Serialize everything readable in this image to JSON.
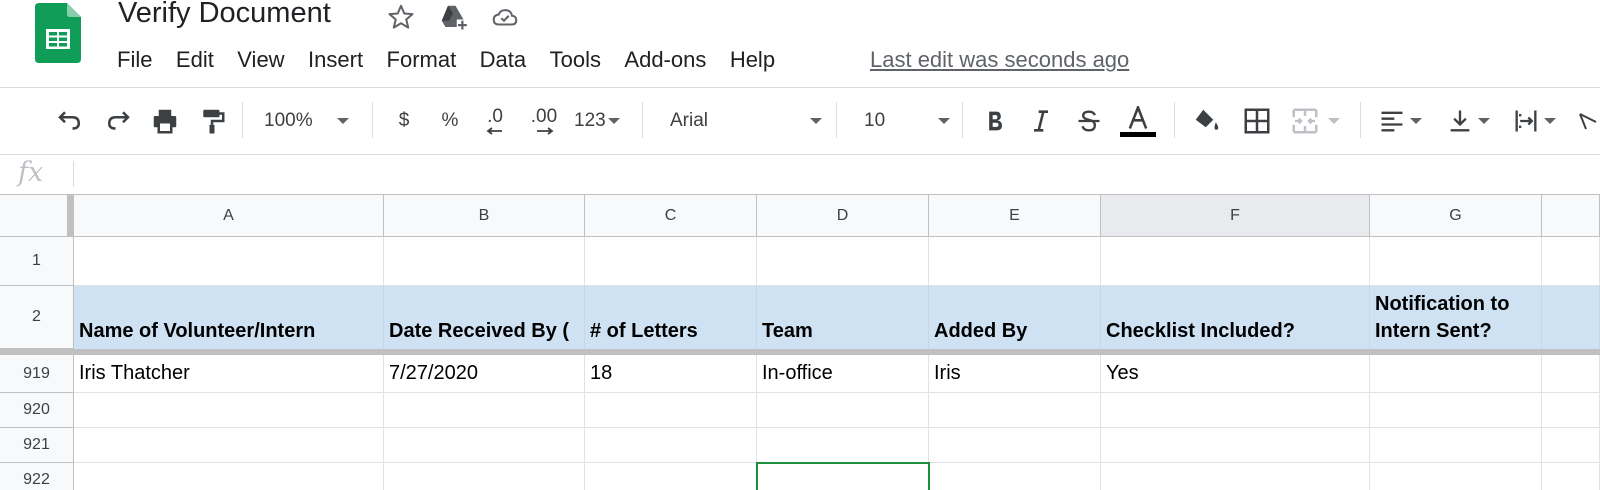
{
  "app": {
    "doc_title": "Verify Document",
    "menu": [
      "File",
      "Edit",
      "View",
      "Insert",
      "Format",
      "Data",
      "Tools",
      "Add-ons",
      "Help"
    ],
    "last_edit": "Last edit was seconds ago"
  },
  "toolbar": {
    "zoom": "100%",
    "currency": "$",
    "percent": "%",
    "decrease_decimal": ".0",
    "increase_decimal": ".00",
    "more_formats": "123",
    "font": "Arial",
    "font_size": "10"
  },
  "formula_bar": {
    "fx_label": "fx",
    "value": ""
  },
  "grid": {
    "columns": [
      "A",
      "B",
      "C",
      "D",
      "E",
      "F",
      "G"
    ],
    "selected_column": "F",
    "rows": [
      {
        "num": "1",
        "cells": [
          "",
          "",
          "",
          "",
          "",
          "",
          ""
        ]
      },
      {
        "num": "2",
        "cells": [
          "Name of Volunteer/Intern",
          "Date Received By (",
          "# of Letters",
          "Team",
          "Added By",
          "Checklist Included?",
          "Notification to Intern Sent?"
        ]
      },
      {
        "num": "919",
        "cells": [
          "Iris Thatcher",
          "7/27/2020",
          "18",
          "In-office",
          "Iris",
          "Yes",
          ""
        ]
      },
      {
        "num": "920",
        "cells": [
          "",
          "",
          "",
          "",
          "",
          "",
          ""
        ]
      },
      {
        "num": "921",
        "cells": [
          "",
          "",
          "",
          "",
          "",
          "",
          ""
        ]
      },
      {
        "num": "922",
        "cells": [
          "",
          "",
          "",
          "",
          "",
          "",
          ""
        ]
      }
    ],
    "active_cell": "D922"
  },
  "colors": {
    "header_fill": "#cfe2f3",
    "active_cell_border": "#1e8e3e",
    "sheets_green": "#0f9d58"
  }
}
